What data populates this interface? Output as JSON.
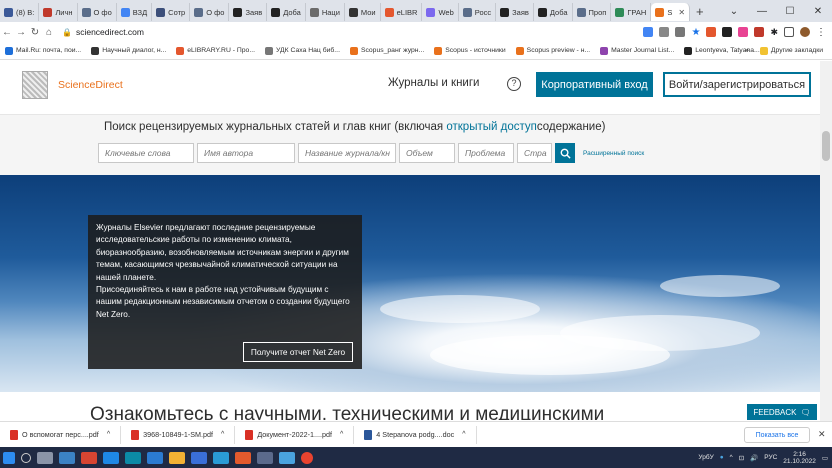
{
  "browser": {
    "tabs": [
      {
        "label": "(8) В:",
        "color": "#3b5998"
      },
      {
        "label": "Личн",
        "color": "#c0392b"
      },
      {
        "label": "О фо",
        "color": "#5a6d8a"
      },
      {
        "label": "ВЗД",
        "color": "#4285f4"
      },
      {
        "label": "Сотр",
        "color": "#3c4f7a"
      },
      {
        "label": "О фо",
        "color": "#5a6d8a"
      },
      {
        "label": "Заяв",
        "color": "#222222"
      },
      {
        "label": "Доба",
        "color": "#222222"
      },
      {
        "label": "Наци",
        "color": "#6b6b6b"
      },
      {
        "label": "Мои",
        "color": "#333333"
      },
      {
        "label": "eLIBR",
        "color": "#e4572e"
      },
      {
        "label": "Web",
        "color": "#7b68ee"
      },
      {
        "label": "Росс",
        "color": "#5a6d8a"
      },
      {
        "label": "Заяв",
        "color": "#222222"
      },
      {
        "label": "Доба",
        "color": "#222222"
      },
      {
        "label": "Проп",
        "color": "#5a6d8a"
      },
      {
        "label": "ГРАН",
        "color": "#2e8b57"
      },
      {
        "label": "S",
        "color": "#e9711c",
        "active": true
      }
    ],
    "new_tab": "+",
    "url": "sciencedirect.com",
    "bookmarks": [
      {
        "label": "Mail.Ru: почта, пои...",
        "color": "#1e6fd9"
      },
      {
        "label": "Научный диалог, н...",
        "color": "#333333"
      },
      {
        "label": "eLIBRARY.RU - Про...",
        "color": "#e4572e"
      },
      {
        "label": "УДК Саха Нац биб...",
        "color": "#777777"
      },
      {
        "label": "Scopus_ранг журн...",
        "color": "#e9711c"
      },
      {
        "label": "Scopus - источники",
        "color": "#e9711c"
      },
      {
        "label": "Scopus preview - н...",
        "color": "#e9711c"
      },
      {
        "label": "Master Journal List...",
        "color": "#8e44ad"
      },
      {
        "label": "Leontyeva, Tatyana...",
        "color": "#222222"
      }
    ],
    "bookmarks_more": "»",
    "other_bookmarks": "Другие закладки"
  },
  "site": {
    "logo_text": "ScienceDirect",
    "nav_journals": "Журналы и книги",
    "help_symbol": "?",
    "corp_login": "Корпоративный вход",
    "login_register": "Войти/зарегистрироваться"
  },
  "search": {
    "heading_before": "Поиск рецензируемых журнальных статей и глав книг (включая ",
    "heading_link": "открытый доступ",
    "heading_after": "содержание)",
    "keywords_placeholder": "Ключевые слова",
    "author_placeholder": "Имя автора",
    "journal_placeholder": "Название журнала/кн",
    "volume_placeholder": "Объем",
    "issue_placeholder": "Проблема",
    "page_placeholder": "Стра",
    "advanced": "Расширенный поиск"
  },
  "hero": {
    "text_line_1": "Журналы Elsevier предлагают последние рецензируемые исследовательские работы по изменению климата, биоразнообразию, возобновляемым источникам энергии и другим темам, касающимся чрезвычайной климатической ситуации на нашей планете.",
    "text_line_2": "Присоединяйтесь к нам в работе над устойчивым будущим с нашим редакционным независимым отчетом о создании будущего Net Zero.",
    "button": "Получите отчет Net Zero"
  },
  "teaser": "Ознакомьтесь с научными, техническими и медицинскими",
  "feedback": "FEEDBACK",
  "downloads": {
    "items": [
      {
        "name": "О вспомогат перс....pdf",
        "color": "#d93025"
      },
      {
        "name": "3968-10849-1-SM.pdf",
        "color": "#d93025"
      },
      {
        "name": "Документ-2022-1....pdf",
        "color": "#d93025"
      },
      {
        "name": "4 Stepanova podg....doc",
        "color": "#2b579a"
      }
    ],
    "show_all": "Показать все"
  },
  "taskbar": {
    "user": "УрбУ",
    "lang": "РУС",
    "time": "2:16",
    "date": "21.10.2022"
  }
}
